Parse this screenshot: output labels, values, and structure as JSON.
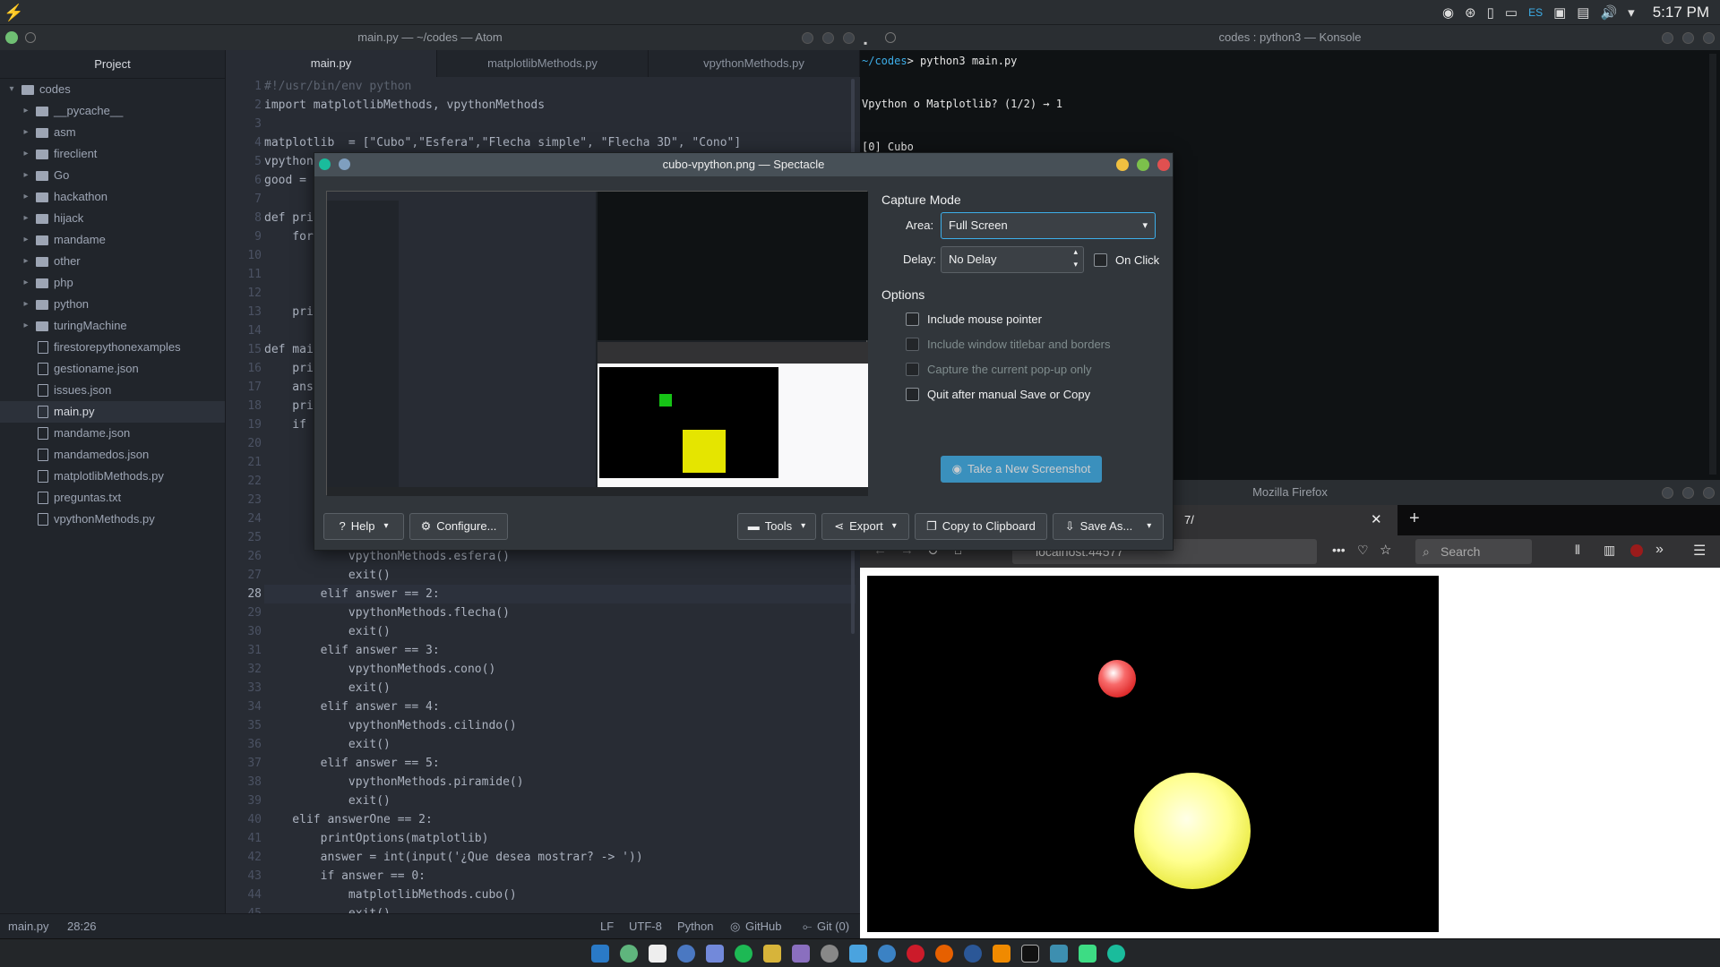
{
  "top_panel": {
    "clock": "5:17 PM",
    "lang": "ES"
  },
  "atom": {
    "title": "main.py — ~/codes — Atom",
    "project_label": "Project",
    "tabs": [
      "main.py",
      "matplotlibMethods.py",
      "vpythonMethods.py"
    ],
    "tree": [
      {
        "name": "codes",
        "type": "root"
      },
      {
        "name": "__pycache__",
        "type": "folder"
      },
      {
        "name": "asm",
        "type": "folder"
      },
      {
        "name": "fireclient",
        "type": "folder"
      },
      {
        "name": "Go",
        "type": "folder"
      },
      {
        "name": "hackathon",
        "type": "folder"
      },
      {
        "name": "hijack",
        "type": "folder"
      },
      {
        "name": "mandame",
        "type": "folder"
      },
      {
        "name": "other",
        "type": "folder"
      },
      {
        "name": "php",
        "type": "folder"
      },
      {
        "name": "python",
        "type": "folder"
      },
      {
        "name": "turingMachine",
        "type": "folder"
      },
      {
        "name": "firestorepythonexamples",
        "type": "file"
      },
      {
        "name": "gestioname.json",
        "type": "file"
      },
      {
        "name": "issues.json",
        "type": "file"
      },
      {
        "name": "main.py",
        "type": "file",
        "selected": true
      },
      {
        "name": "mandame.json",
        "type": "file"
      },
      {
        "name": "mandamedos.json",
        "type": "file"
      },
      {
        "name": "matplotlibMethods.py",
        "type": "file"
      },
      {
        "name": "preguntas.txt",
        "type": "file"
      },
      {
        "name": "vpythonMethods.py",
        "type": "file"
      }
    ],
    "line_numbers": [
      "1",
      "2",
      "3",
      "4",
      "5",
      "6",
      "7",
      "8",
      "9",
      "10",
      "11",
      "12",
      "13",
      "14",
      "15",
      "16",
      "17",
      "18",
      "19",
      "20",
      "21",
      "22",
      "23",
      "24",
      "25",
      "26",
      "27",
      "28",
      "29",
      "30",
      "31",
      "32",
      "33",
      "34",
      "35",
      "36",
      "37",
      "38",
      "39",
      "40",
      "41",
      "42",
      "43",
      "44",
      "45"
    ],
    "code_lines": [
      "#!/usr/bin/env python",
      "import matplotlibMethods, vpythonMethods",
      "",
      "matplotlib  = [\"Cubo\",\"Esfera\",\"Flecha simple\", \"Flecha 3D\", \"Cono\"]",
      "vpython",
      "good =",
      "",
      "def pri",
      "    for",
      "",
      "",
      "",
      "    pri",
      "",
      "def mai",
      "    pri",
      "    ans",
      "    pri",
      "    if",
      "",
      "",
      "",
      "",
      "",
      "",
      "            vpythonMethods.esfera()",
      "            exit()",
      "        elif answer == 2:",
      "            vpythonMethods.flecha()",
      "            exit()",
      "        elif answer == 3:",
      "            vpythonMethods.cono()",
      "            exit()",
      "        elif answer == 4:",
      "            vpythonMethods.cilindo()",
      "            exit()",
      "        elif answer == 5:",
      "            vpythonMethods.piramide()",
      "            exit()",
      "    elif answerOne == 2:",
      "        printOptions(matplotlib)",
      "        answer = int(input('¿Que desea mostrar? -> '))",
      "        if answer == 0:",
      "            matplotlibMethods.cubo()",
      "            exit()"
    ],
    "status": {
      "file": "main.py",
      "cursor": "28:26",
      "eol": "LF",
      "encoding": "UTF-8",
      "grammar": "Python",
      "github": "GitHub",
      "git": "Git (0)"
    }
  },
  "konsole": {
    "title": "codes : python3 — Konsole",
    "prompt_path": "~/codes",
    "command": "python3 main.py",
    "line2": "Vpython o Matplotlib? (1/2) → 1",
    "line3": "[0] Cubo"
  },
  "firefox": {
    "title": "Mozilla Firefox",
    "tab_label": "7/",
    "url": "localhost:44577",
    "search_placeholder": "Search"
  },
  "spectacle": {
    "title": "cubo-vpython.png — Spectacle",
    "capture_mode": "Capture Mode",
    "area_label": "Area:",
    "area_value": "Full Screen",
    "delay_label": "Delay:",
    "delay_value": "No Delay",
    "on_click": "On Click",
    "options": "Options",
    "opt1": "Include mouse pointer",
    "opt2": "Include window titlebar and borders",
    "opt3": "Capture the current pop-up only",
    "opt4": "Quit after manual Save or Copy",
    "new_shot": "Take a New Screenshot",
    "help": "Help",
    "configure": "Configure...",
    "tools": "Tools",
    "export": "Export",
    "copy": "Copy to Clipboard",
    "save": "Save As..."
  }
}
